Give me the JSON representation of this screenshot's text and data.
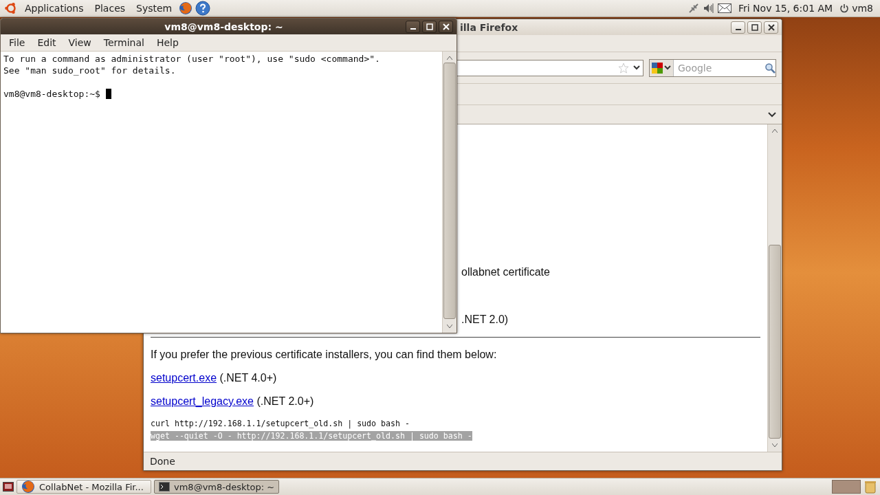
{
  "top_panel": {
    "menus": [
      "Applications",
      "Places",
      "System"
    ],
    "clock": "Fri Nov 15, 6:01 AM",
    "user": "vm8"
  },
  "terminal": {
    "title": "vm8@vm8-desktop: ~",
    "menu": [
      "File",
      "Edit",
      "View",
      "Terminal",
      "Help"
    ],
    "lines": [
      "To run a command as administrator (user \"root\"), use \"sudo <command>\".",
      "See \"man sudo_root\" for details."
    ],
    "prompt": "vm8@vm8-desktop:~$"
  },
  "firefox": {
    "title": "illa Firefox",
    "search": {
      "placeholder": "Google"
    },
    "fragments": [
      "ollabnet certificate",
      ".NET 2.0)"
    ],
    "paragraph": "If you prefer the previous certificate installers, you can find them below:",
    "downloads": [
      {
        "link": "setupcert.exe",
        "note": "(.NET 4.0+)"
      },
      {
        "link": "setupcert_legacy.exe",
        "note": "(.NET 2.0+)"
      }
    ],
    "commands": [
      {
        "text": "curl http://192.168.1.1/setupcert_old.sh | sudo bash -",
        "selected": false
      },
      {
        "text": "wget --quiet -O - http://192.168.1.1/setupcert_old.sh | sudo bash -",
        "selected": true
      }
    ],
    "status": "Done"
  },
  "taskbar": {
    "tasks": [
      {
        "label": "CollabNet - Mozilla Fir...",
        "kind": "browser",
        "selected": false
      },
      {
        "label": "vm8@vm8-desktop: ~",
        "kind": "terminal",
        "selected": true
      }
    ]
  }
}
